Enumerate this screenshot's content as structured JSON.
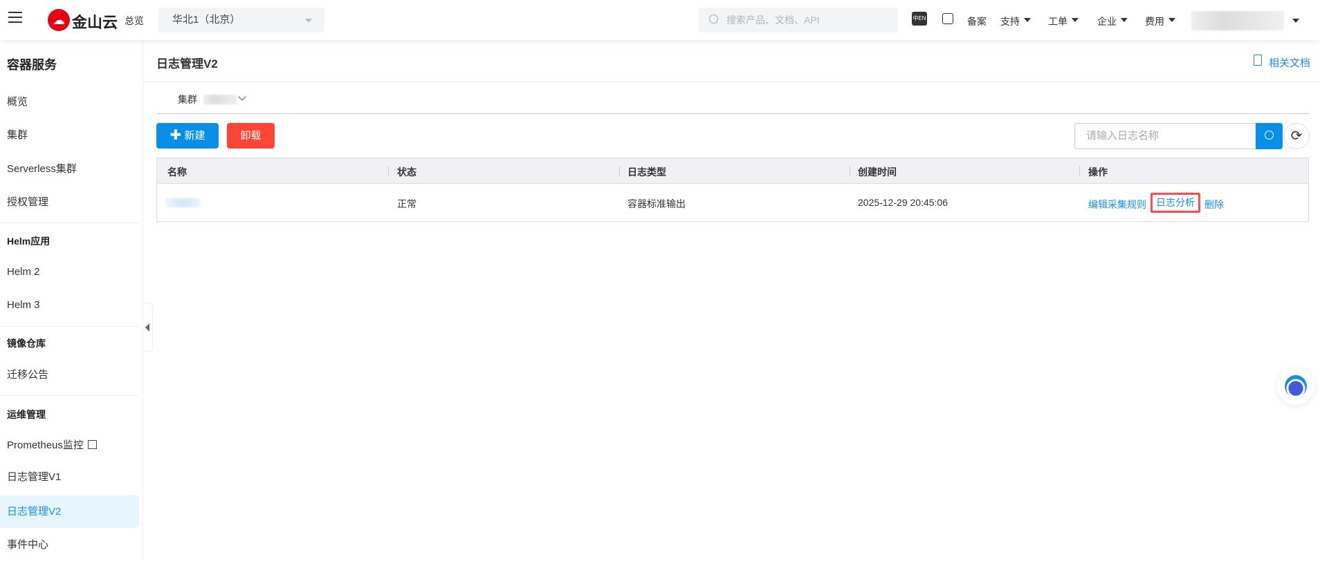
{
  "header": {
    "logo_text": "金山云",
    "overview": "总览",
    "region": "华北1（北京）",
    "search_placeholder": "搜索产品、文档、API",
    "lang_icon": "中EN",
    "nav": [
      "备案",
      "支持",
      "工单",
      "企业",
      "费用"
    ]
  },
  "sidebar": {
    "title": "容器服务",
    "items": [
      "概览",
      "集群",
      "Serverless集群",
      "授权管理"
    ],
    "groups": [
      {
        "label": "Helm应用",
        "items": [
          "Helm 2",
          "Helm 3"
        ]
      },
      {
        "label": "镜像仓库",
        "items": [
          "迁移公告"
        ]
      },
      {
        "label": "运维管理",
        "items": [
          "Prometheus监控",
          "日志管理V1",
          "日志管理V2",
          "事件中心"
        ]
      }
    ],
    "active": "日志管理V2"
  },
  "main": {
    "title": "日志管理V2",
    "docs_link": "相关文档",
    "cluster_label": "集群",
    "new_button": "新建",
    "uninstall_button": "卸载",
    "search_placeholder": "请输入日志名称",
    "table": {
      "columns": [
        "名称",
        "状态",
        "日志类型",
        "创建时间",
        "操作"
      ],
      "rows": [
        {
          "status": "正常",
          "log_type": "容器标准输出",
          "created": "2025-12-29 20:45:06",
          "actions": [
            "编辑采集规则",
            "日志分析",
            "删除"
          ]
        }
      ]
    }
  },
  "colors": {
    "primary": "#0a8fe8",
    "danger": "#ff4536",
    "highlight": "#ff4d4f"
  }
}
